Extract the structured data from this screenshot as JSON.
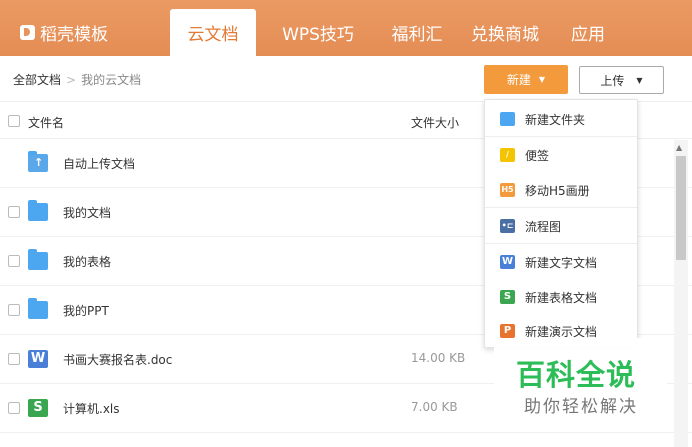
{
  "nav": {
    "brand": "稻壳模板",
    "tabs": [
      "云文档",
      "WPS技巧",
      "福利汇",
      "兑换商城",
      "应用"
    ]
  },
  "breadcrumb": {
    "root": "全部文档",
    "separator": ">",
    "current": "我的云文档"
  },
  "toolbar": {
    "new_label": "新建",
    "upload_label": "上传"
  },
  "table": {
    "col_name": "文件名",
    "col_size": "文件大小"
  },
  "files": [
    {
      "name": "自动上传文档",
      "size": ""
    },
    {
      "name": "我的文档",
      "size": ""
    },
    {
      "name": "我的表格",
      "size": ""
    },
    {
      "name": "我的PPT",
      "size": ""
    },
    {
      "name": "书画大赛报名表.doc",
      "size": "14.00 KB"
    },
    {
      "name": "计算机.xls",
      "size": "7.00 KB"
    }
  ],
  "new_menu": [
    {
      "label": "新建文件夹",
      "icon": "folder-icon"
    },
    {
      "label": "便签",
      "icon": "note-icon"
    },
    {
      "label": "移动H5画册",
      "icon": "h5-icon"
    },
    {
      "label": "流程图",
      "icon": "flowchart-icon"
    },
    {
      "label": "新建文字文档",
      "icon": "writer-doc-icon"
    },
    {
      "label": "新建表格文档",
      "icon": "spreadsheet-icon"
    },
    {
      "label": "新建演示文档",
      "icon": "presentation-icon"
    }
  ],
  "watermark": {
    "title": "百科全说",
    "subtitle": "助你轻松解决"
  },
  "colors": {
    "nav_bg": "#e8935a",
    "accent": "#f39a3d",
    "folder": "#4ca7f0",
    "watermark": "#2dbd58"
  }
}
